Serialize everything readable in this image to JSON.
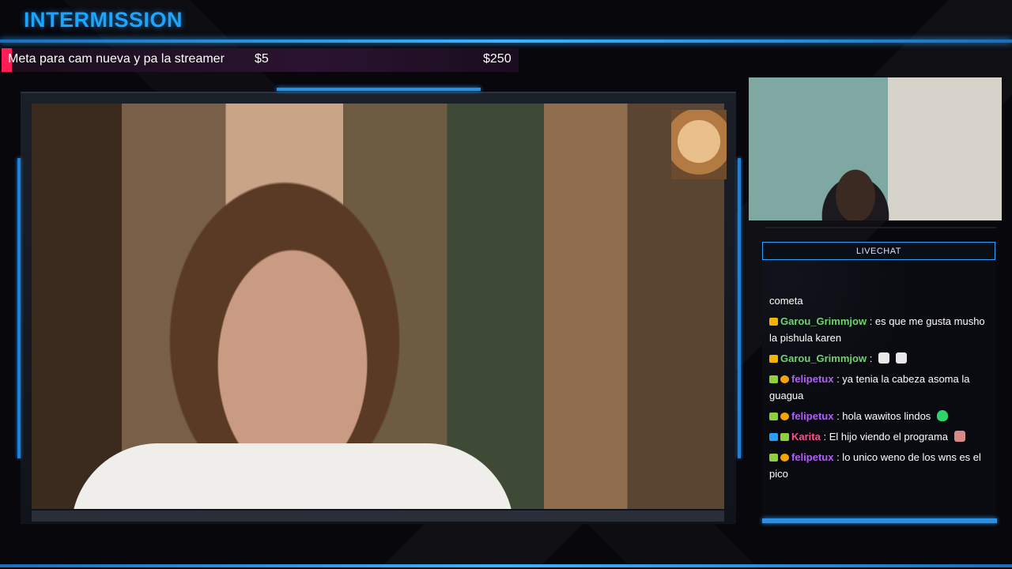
{
  "overlay": {
    "title": "INTERMISSION"
  },
  "goal": {
    "label": "Meta para cam nueva y pa la streamer",
    "current": "$5",
    "target": "$250",
    "progress_fraction": 0.02,
    "accent_color": "#ff1d55"
  },
  "chat": {
    "header": "LIVECHAT",
    "partial_line": "cometa",
    "messages": [
      {
        "user": "Garou_Grimmjow",
        "user_color": "#6fd36f",
        "badges": [
          "crown-icon"
        ],
        "text": ": es que me gusta musho la pishula karen",
        "emotes": []
      },
      {
        "user": "Garou_Grimmjow",
        "user_color": "#6fd36f",
        "badges": [
          "crown-icon"
        ],
        "text": ":",
        "emotes": [
          "skull-emote",
          "skull-emote"
        ]
      },
      {
        "user": "felipetux",
        "user_color": "#b45cff",
        "badges": [
          "cat-icon",
          "coin-icon"
        ],
        "text": ": ya tenia la cabeza asoma la guagua",
        "emotes": []
      },
      {
        "user": "felipetux",
        "user_color": "#b45cff",
        "badges": [
          "cat-icon",
          "coin-icon"
        ],
        "text": ": hola wawitos lindos",
        "emotes": [
          "green-heart-emote"
        ]
      },
      {
        "user": "Karita",
        "user_color": "#ff4f8a",
        "badges": [
          "prime-icon",
          "cat-icon"
        ],
        "text": ": El hijo viendo el programa",
        "emotes": [
          "pink-emote"
        ]
      },
      {
        "user": "felipetux",
        "user_color": "#b45cff",
        "badges": [
          "cat-icon",
          "coin-icon"
        ],
        "text": ": lo unico weno de los wns es el pico",
        "emotes": []
      }
    ]
  },
  "colors": {
    "accent_blue": "#1aa6ff",
    "frame_dark": "#11131a"
  }
}
